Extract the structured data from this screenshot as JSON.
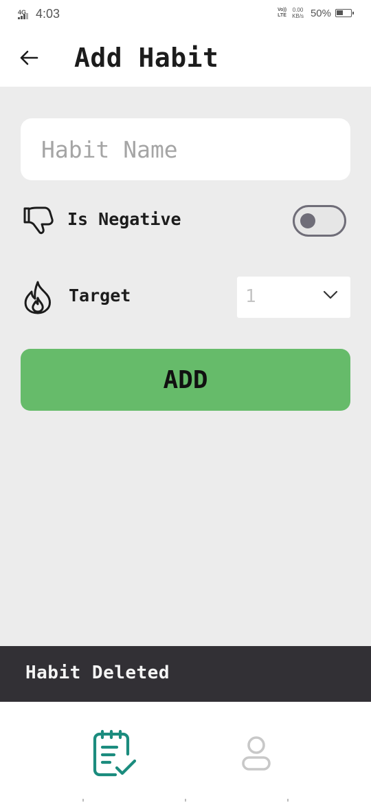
{
  "status_bar": {
    "network": "4G",
    "time": "4:03",
    "volte_top": "Vo))",
    "volte_bottom": "LTE",
    "speed_value": "0.00",
    "speed_unit": "KB/s",
    "battery": "50%"
  },
  "app_bar": {
    "title": "Add Habit",
    "back_icon": "arrow-left-icon"
  },
  "form": {
    "habit_name_placeholder": "Habit Name",
    "habit_name_value": "",
    "negative": {
      "label": "Is Negative",
      "icon": "thumbs-down-icon",
      "enabled": false
    },
    "target": {
      "label": "Target",
      "icon": "flame-icon",
      "value": "1"
    },
    "add_label": "ADD"
  },
  "snackbar": {
    "message": "Habit Deleted"
  },
  "bottom_nav": {
    "items": [
      {
        "name": "habits",
        "icon": "notepad-check-icon",
        "active": true
      },
      {
        "name": "profile",
        "icon": "person-icon",
        "active": false
      }
    ]
  },
  "colors": {
    "accent_green": "#66bb6a",
    "nav_active": "#1b8c7e",
    "nav_inactive": "#c8c8c8",
    "background": "#ececec",
    "snackbar": "#323035"
  }
}
